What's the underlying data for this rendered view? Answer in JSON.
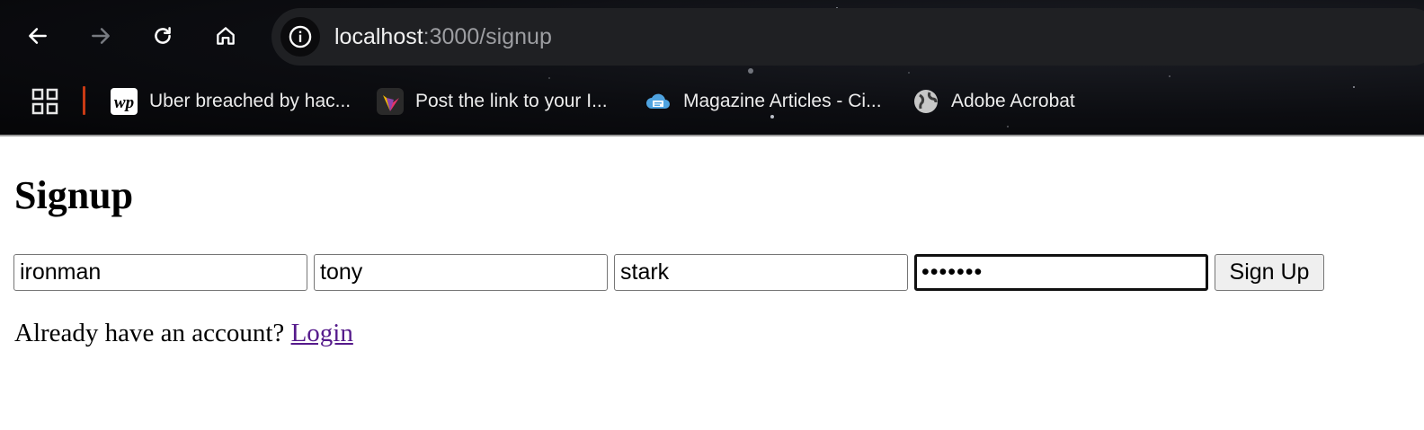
{
  "browser": {
    "address_bar": {
      "host": "localhost",
      "path": ":3000/signup"
    },
    "nav_icons": [
      "back-arrow-icon",
      "forward-arrow-icon",
      "reload-icon",
      "home-icon"
    ],
    "bookmarks": [
      {
        "label": "Uber breached by hac...",
        "icon": "washington-post-icon"
      },
      {
        "label": "Post the link to your I...",
        "icon": "colorful-leaf-icon"
      },
      {
        "label": "Magazine Articles - Ci...",
        "icon": "cloud-news-icon"
      },
      {
        "label": "Adobe Acrobat",
        "icon": "globe-icon"
      }
    ]
  },
  "page": {
    "title": "Signup",
    "form": {
      "username": "ironman",
      "first_name": "tony",
      "last_name": "stark",
      "password_masked": "•••••••",
      "submit_label": "Sign Up"
    },
    "login_prompt": "Already have an account?",
    "login_link": "Login"
  },
  "colors": {
    "chrome_bg": "#0c0d11",
    "omnibox_bg": "#1f2023",
    "link_visited": "#551a8b",
    "bookmark_separator": "#c83a14"
  }
}
